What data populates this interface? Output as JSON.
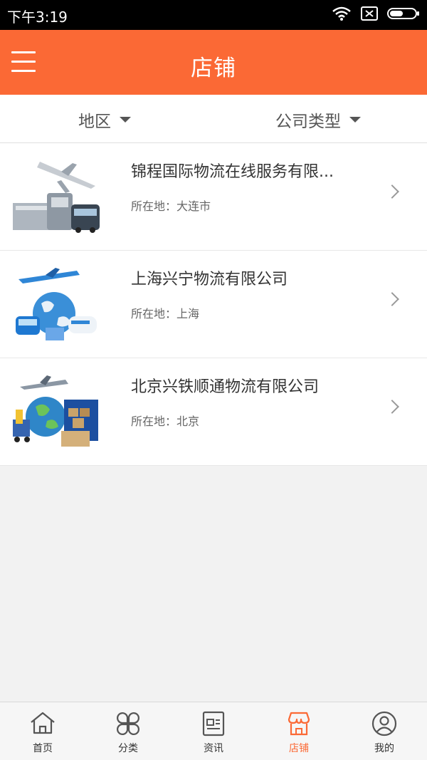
{
  "status": {
    "time": "下午3:19"
  },
  "header": {
    "title": "店铺"
  },
  "filters": {
    "region": "地区",
    "company_type": "公司类型"
  },
  "stores": [
    {
      "name": "锦程国际物流在线服务有限...",
      "location": "所在地：大连市"
    },
    {
      "name": "上海兴宁物流有限公司",
      "location": "所在地：上海"
    },
    {
      "name": "北京兴铁顺通物流有限公司",
      "location": "所在地：北京"
    }
  ],
  "tabs": [
    {
      "label": "首页",
      "icon": "home-icon"
    },
    {
      "label": "分类",
      "icon": "category-icon"
    },
    {
      "label": "资讯",
      "icon": "news-icon"
    },
    {
      "label": "店铺",
      "icon": "shop-icon",
      "active": true
    },
    {
      "label": "我的",
      "icon": "user-icon"
    }
  ],
  "colors": {
    "accent": "#fb6935",
    "status_bar": "#000000",
    "background": "#f2f2f2"
  }
}
